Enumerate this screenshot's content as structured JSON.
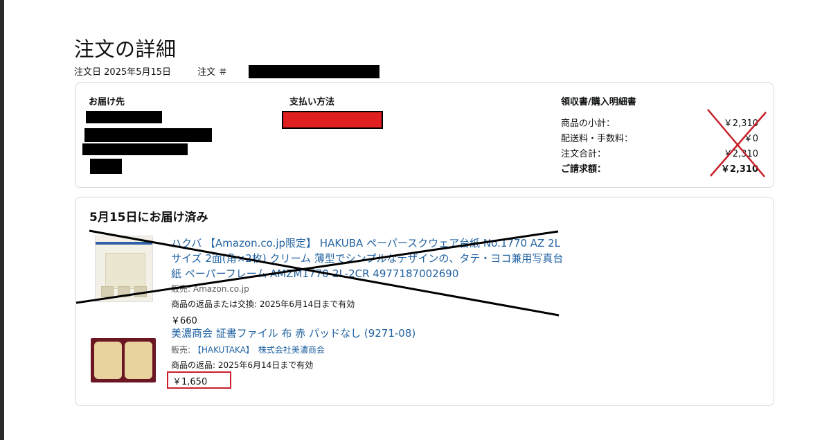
{
  "page": {
    "title": "注文の詳細",
    "order_date_label": "注文日",
    "order_date": "2025年5月15日",
    "order_no_label": "注文 ＃"
  },
  "summary": {
    "shipping_title": "お届け先",
    "payment_title": "支払い方法",
    "receipt_title": "領収書/購入明細書",
    "rows": [
      {
        "label": "商品の小計：",
        "value": "￥2,310"
      },
      {
        "label": "配送料・手数料：",
        "value": "￥0"
      },
      {
        "label": "注文合計：",
        "value": "￥2,310"
      },
      {
        "label": "ご請求額：",
        "value": "￥2,310"
      }
    ]
  },
  "shipment": {
    "title": "5月15日にお届け済み",
    "items": [
      {
        "title_lines": [
          "ハクバ 【Amazon.co.jp限定】 HAKUBA ペーパースクウェア台紙 No.1770 AZ 2L",
          "サイズ 2面(角×2枚) クリーム 薄型でシンプルなデザインの、タテ・ヨコ兼用写真台",
          "紙 ペーパーフレーム AMZM1770-2L-2CR 4977187002690"
        ],
        "seller_label": "販売:",
        "seller": "Amazon.co.jp",
        "return_note": "商品の返品または交換: 2025年6月14日まで有効",
        "price": "￥660"
      },
      {
        "title": "美濃商会 証書ファイル 布 赤 パッドなし (9271-08)",
        "seller_label": "販売:",
        "seller": "【HAKUTAKA】　株式会社美濃商会",
        "return_note": "商品の返品: 2025年6月14日まで有効",
        "price": "￥1,650"
      }
    ]
  },
  "colors": {
    "link": "#2162a1",
    "annotation_red": "#c7202a",
    "payment_redaction": "#e02020"
  }
}
